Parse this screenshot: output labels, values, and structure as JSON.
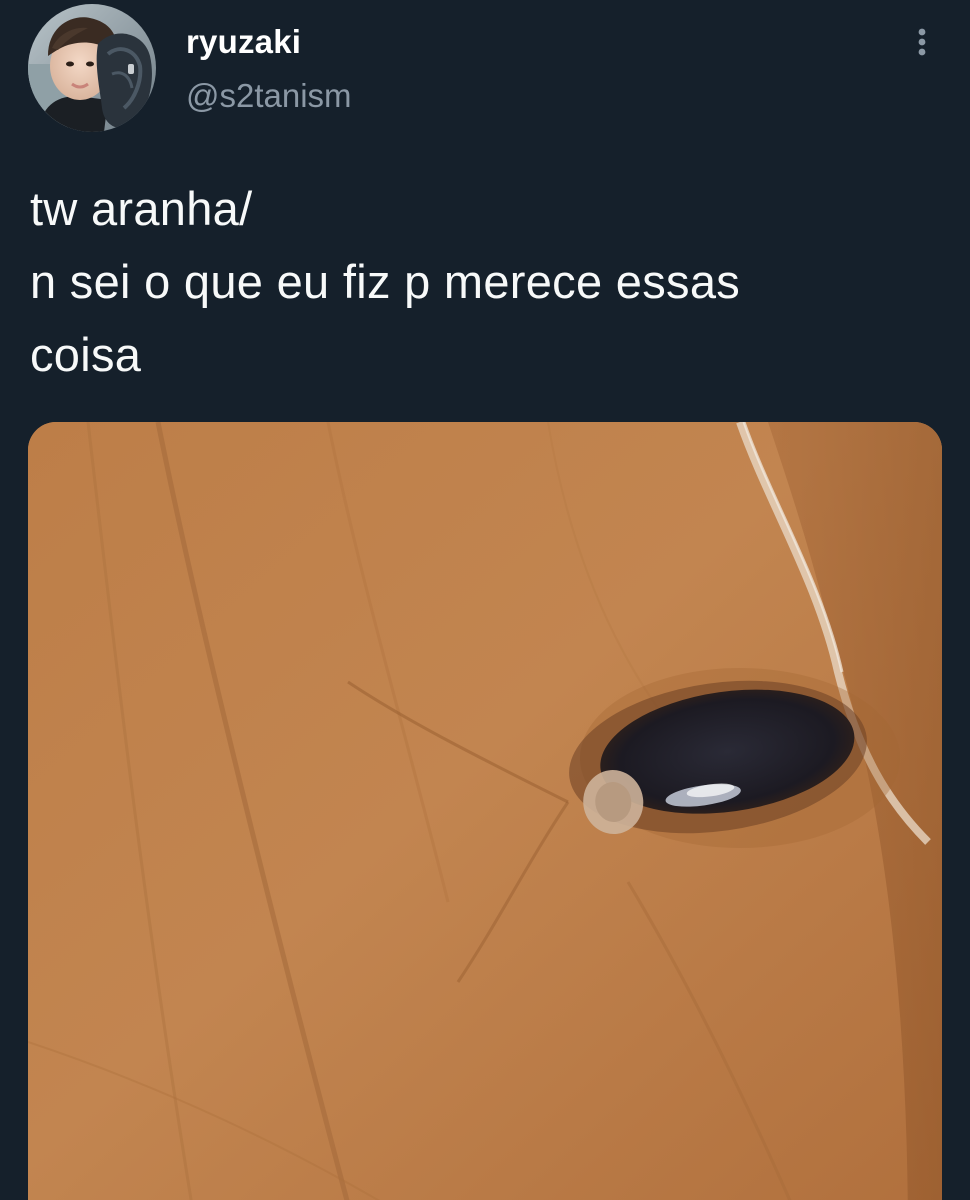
{
  "tweet": {
    "author": {
      "display_name": "ryuzaki",
      "handle": "@s2tanism"
    },
    "text_lines": [
      "tw aranha/",
      "n sei o que eu fiz p merece essas",
      "coisa"
    ],
    "icons": {
      "avatar": "user-avatar-photo",
      "more": "more-vertical-icon"
    },
    "colors": {
      "background": "#15202b",
      "name": "#ffffff",
      "handle": "#8b98a5",
      "text": "#f7f9f9"
    }
  }
}
